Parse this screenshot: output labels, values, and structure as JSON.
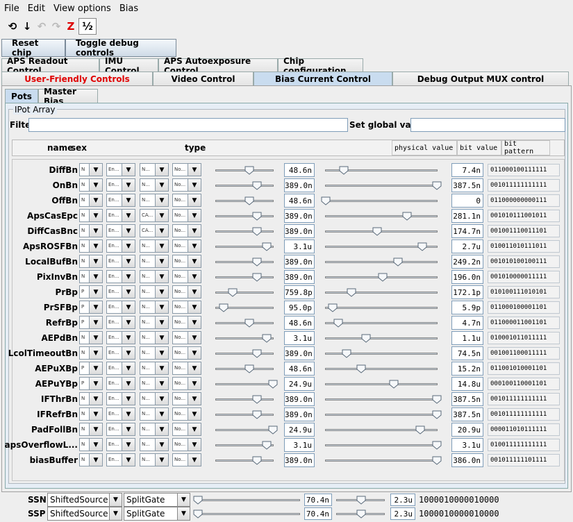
{
  "menu": [
    "File",
    "Edit",
    "View options",
    "Bias"
  ],
  "toolbar": {
    "icons": [
      "reset-icon",
      "down-arrow-icon",
      "undo-icon",
      "redo-icon",
      "zap-icon",
      "bias-toggle-icon"
    ],
    "glyphs": [
      "⟲",
      "↓",
      "↶",
      "↷",
      "Z",
      "½"
    ]
  },
  "actions": {
    "reset_chip": "Reset chip",
    "toggle_debug": "Toggle debug controls"
  },
  "tabs_row1": [
    "APS Readout Control",
    "IMU Control",
    "APS Autoexposure Control",
    "Chip configuration"
  ],
  "tabs_row2": [
    "User-Friendly Controls",
    "Video Control",
    "Bias Current Control",
    "Debug Output MUX control"
  ],
  "active_tab": "Bias Current Control",
  "subtabs": [
    "Pots",
    "Master Bias"
  ],
  "ipot": {
    "group_label": "IPot Array",
    "filter_label": "Filter",
    "filter_value": "",
    "global_label": "Set global value",
    "global_value": ""
  },
  "header": {
    "name": "name",
    "sex": "sex",
    "type": "type",
    "physical_value": "physical value",
    "bit_value": "bit value",
    "bit_pattern": "bit pattern"
  },
  "pots": [
    {
      "name": "DiffBn",
      "sex": "N",
      "en": "En...",
      "type": "N...",
      "cas": "No...",
      "slider1": 0.58,
      "value": "48.6n",
      "slider2": 0.16,
      "bitval": "7.4n",
      "bits": "011000100111111"
    },
    {
      "name": "OnBn",
      "sex": "N",
      "en": "En...",
      "type": "N...",
      "cas": "No...",
      "slider1": 0.72,
      "value": "389.0n",
      "slider2": 1.0,
      "bitval": "387.5n",
      "bits": "001011111111111"
    },
    {
      "name": "OffBn",
      "sex": "N",
      "en": "En...",
      "type": "N...",
      "cas": "No...",
      "slider1": 0.58,
      "value": "48.6n",
      "slider2": 0.0,
      "bitval": "0",
      "bits": "011000000000111"
    },
    {
      "name": "ApsCasEpc",
      "sex": "N",
      "en": "En...",
      "type": "CA...",
      "cas": "No...",
      "slider1": 0.72,
      "value": "389.0n",
      "slider2": 0.73,
      "bitval": "281.1n",
      "bits": "001010111001011"
    },
    {
      "name": "DiffCasBnc",
      "sex": "N",
      "en": "En...",
      "type": "CA...",
      "cas": "No...",
      "slider1": 0.72,
      "value": "389.0n",
      "slider2": 0.46,
      "bitval": "174.7n",
      "bits": "001001110011101"
    },
    {
      "name": "ApsROSFBn",
      "sex": "N",
      "en": "En...",
      "type": "N...",
      "cas": "No...",
      "slider1": 0.89,
      "value": "3.1u",
      "slider2": 0.87,
      "bitval": "2.7u",
      "bits": "010011010111011"
    },
    {
      "name": "LocalBufBn",
      "sex": "N",
      "en": "En...",
      "type": "N...",
      "cas": "No...",
      "slider1": 0.72,
      "value": "389.0n",
      "slider2": 0.65,
      "bitval": "249.2n",
      "bits": "001010100100111"
    },
    {
      "name": "PixInvBn",
      "sex": "N",
      "en": "En...",
      "type": "N...",
      "cas": "No...",
      "slider1": 0.72,
      "value": "389.0n",
      "slider2": 0.51,
      "bitval": "196.0n",
      "bits": "001010000011111"
    },
    {
      "name": "PrBp",
      "sex": "P",
      "en": "En...",
      "type": "N...",
      "cas": "No...",
      "slider1": 0.29,
      "value": "759.8p",
      "slider2": 0.23,
      "bitval": "172.1p",
      "bits": "010100111010101"
    },
    {
      "name": "PrSFBp",
      "sex": "P",
      "en": "En...",
      "type": "N...",
      "cas": "No...",
      "slider1": 0.14,
      "value": "95.0p",
      "slider2": 0.06,
      "bitval": "5.9p",
      "bits": "011000100001101"
    },
    {
      "name": "RefrBp",
      "sex": "P",
      "en": "En...",
      "type": "N...",
      "cas": "No...",
      "slider1": 0.58,
      "value": "48.6n",
      "slider2": 0.11,
      "bitval": "4.7n",
      "bits": "011000011001101"
    },
    {
      "name": "AEPdBn",
      "sex": "N",
      "en": "En...",
      "type": "N...",
      "cas": "No...",
      "slider1": 0.89,
      "value": "3.1u",
      "slider2": 0.36,
      "bitval": "1.1u",
      "bits": "010001011011111"
    },
    {
      "name": "LcolTimeoutBn",
      "sex": "N",
      "en": "En...",
      "type": "N...",
      "cas": "No...",
      "slider1": 0.72,
      "value": "389.0n",
      "slider2": 0.19,
      "bitval": "74.5n",
      "bits": "001001100011111"
    },
    {
      "name": "AEPuXBp",
      "sex": "P",
      "en": "En...",
      "type": "N...",
      "cas": "No...",
      "slider1": 0.58,
      "value": "48.6n",
      "slider2": 0.32,
      "bitval": "15.2n",
      "bits": "011001010001101"
    },
    {
      "name": "AEPuYBp",
      "sex": "P",
      "en": "En...",
      "type": "N...",
      "cas": "No...",
      "slider1": 1.0,
      "value": "24.9u",
      "slider2": 0.61,
      "bitval": "14.8u",
      "bits": "000100110001101"
    },
    {
      "name": "IFThrBn",
      "sex": "N",
      "en": "En...",
      "type": "N...",
      "cas": "No...",
      "slider1": 0.72,
      "value": "389.0n",
      "slider2": 1.0,
      "bitval": "387.5n",
      "bits": "001011111111111"
    },
    {
      "name": "IFRefrBn",
      "sex": "N",
      "en": "En...",
      "type": "N...",
      "cas": "No...",
      "slider1": 0.72,
      "value": "389.0n",
      "slider2": 1.0,
      "bitval": "387.5n",
      "bits": "001011111111111"
    },
    {
      "name": "PadFollBn",
      "sex": "N",
      "en": "En...",
      "type": "N...",
      "cas": "No...",
      "slider1": 1.0,
      "value": "24.9u",
      "slider2": 0.85,
      "bitval": "20.9u",
      "bits": "000011010111111"
    },
    {
      "name": "apsOverflowL...",
      "sex": "N",
      "en": "En...",
      "type": "N...",
      "cas": "No...",
      "slider1": 0.89,
      "value": "3.1u",
      "slider2": 1.0,
      "bitval": "3.1u",
      "bits": "010011111111111"
    },
    {
      "name": "biasBuffer",
      "sex": "N",
      "en": "En...",
      "type": "N...",
      "cas": "No...",
      "slider1": 0.72,
      "value": "389.0n",
      "slider2": 1.0,
      "bitval": "386.0n",
      "bits": "001011111101111"
    }
  ],
  "shifted": [
    {
      "name": "SSN",
      "source": "ShiftedSource",
      "gate": "SplitGate",
      "slider1": 0.0,
      "value": "70.4n",
      "slider2": 0.52,
      "bitval": "2.3u",
      "bits": "1000010000010000"
    },
    {
      "name": "SSP",
      "source": "ShiftedSource",
      "gate": "SplitGate",
      "slider1": 0.0,
      "value": "70.4n",
      "slider2": 0.52,
      "bitval": "2.3u",
      "bits": "1000010000010000"
    }
  ]
}
